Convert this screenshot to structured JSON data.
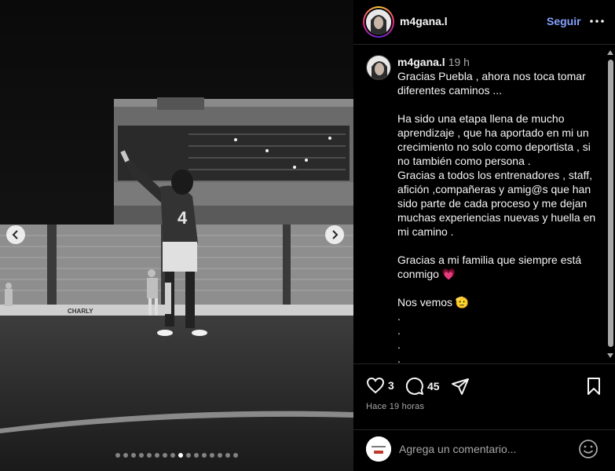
{
  "post": {
    "username": "m4gana.l",
    "follow_label": "Seguir",
    "time_ago": "19 h",
    "caption_lines": [
      "Gracias Puebla , ahora nos toca tomar",
      "diferentes caminos ...",
      "",
      "Ha sido una etapa llena de mucho",
      "aprendizaje , que ha aportado en mi un",
      "crecimiento no solo como deportista , si",
      "no también como persona .",
      "Gracias a todos los entrenadores , staff,",
      "afición ,compañeras y amig@s que han",
      "sido parte  de cada proceso y me dejan",
      "muchas experiencias nuevas y huella en",
      "mi camino .",
      "",
      "Gracias a mi familia que siempre está",
      "conmigo 💗",
      "",
      "Nos vemos 🫡",
      ".",
      ".",
      ".",
      "."
    ],
    "likes": "3",
    "comments": "45",
    "posted_label": "Hace 19 horas",
    "comment_placeholder": "Agrega un comentario...",
    "jersey_number": "4",
    "banner_text": "CHARLY"
  },
  "carousel": {
    "total_slides": 16,
    "active_index": 8
  },
  "icons": {
    "prev": "chevron-left-icon",
    "next": "chevron-right-icon",
    "more": "more-horizontal-icon",
    "like": "heart-icon",
    "comment": "comment-bubble-icon",
    "share": "paper-plane-icon",
    "save": "bookmark-icon",
    "emoji": "smiley-icon"
  },
  "colors": {
    "follow": "#85a1ff",
    "background": "#000000",
    "muted_text": "#a8a8a8",
    "divider": "#262626"
  }
}
